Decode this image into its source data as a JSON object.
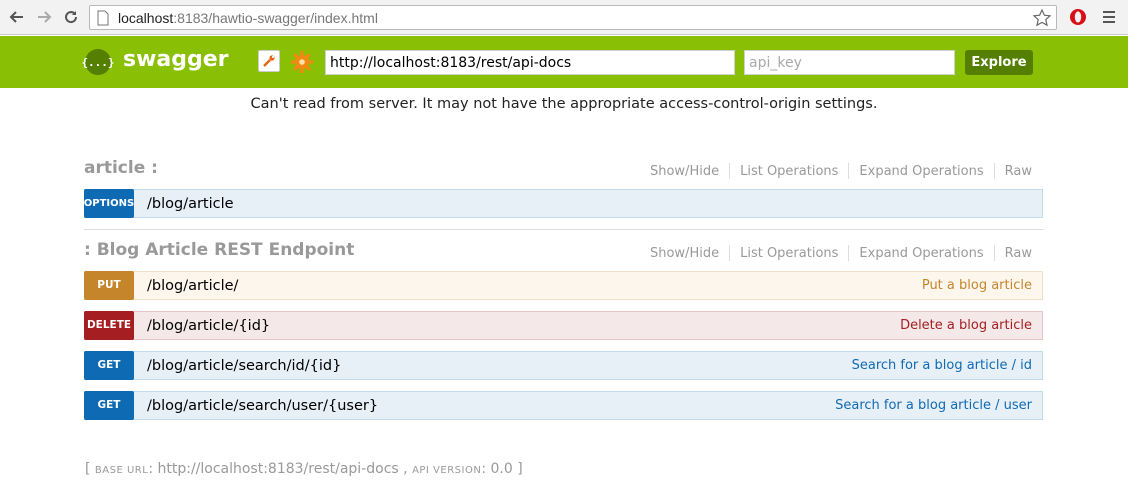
{
  "browser": {
    "url_host": "localhost",
    "url_rest": ":8183/hawtio-swagger/index.html"
  },
  "header": {
    "logo_mark": "{...}",
    "logo_text": "swagger",
    "url_value": "http://localhost:8183/rest/api-docs",
    "api_key_placeholder": "api_key",
    "explore_label": "Explore"
  },
  "message": "Can't read from server. It may not have the appropriate access-control-origin settings.",
  "resource_links": [
    "Show/Hide",
    "List Operations",
    "Expand Operations",
    "Raw"
  ],
  "resources": [
    {
      "title": "article :",
      "operations": [
        {
          "method": "OPTIONS",
          "path": "/blog/article",
          "summary": ""
        }
      ]
    },
    {
      "title": ": Blog Article REST Endpoint",
      "operations": [
        {
          "method": "PUT",
          "path": "/blog/article/",
          "summary": "Put a blog article"
        },
        {
          "method": "DELETE",
          "path": "/blog/article/{id}",
          "summary": "Delete a blog article"
        },
        {
          "method": "GET",
          "path": "/blog/article/search/id/{id}",
          "summary": "Search for a blog article / id"
        },
        {
          "method": "GET",
          "path": "/blog/article/search/user/{user}",
          "summary": "Search for a blog article / user"
        }
      ]
    }
  ],
  "footer": {
    "open": "[",
    "base_url_label": "BASE URL",
    "base_url": "http://localhost:8183/rest/api-docs",
    "sep": ",",
    "api_version_label": "API VERSION",
    "api_version": "0.0",
    "close": "]"
  },
  "colors": {
    "header_bg": "#89bf04",
    "explore_bg": "#547f00",
    "options_badge": "#0f6ab4",
    "put_badge": "#c5862b",
    "delete_badge": "#a41e22",
    "get_badge": "#0f6ab4"
  }
}
